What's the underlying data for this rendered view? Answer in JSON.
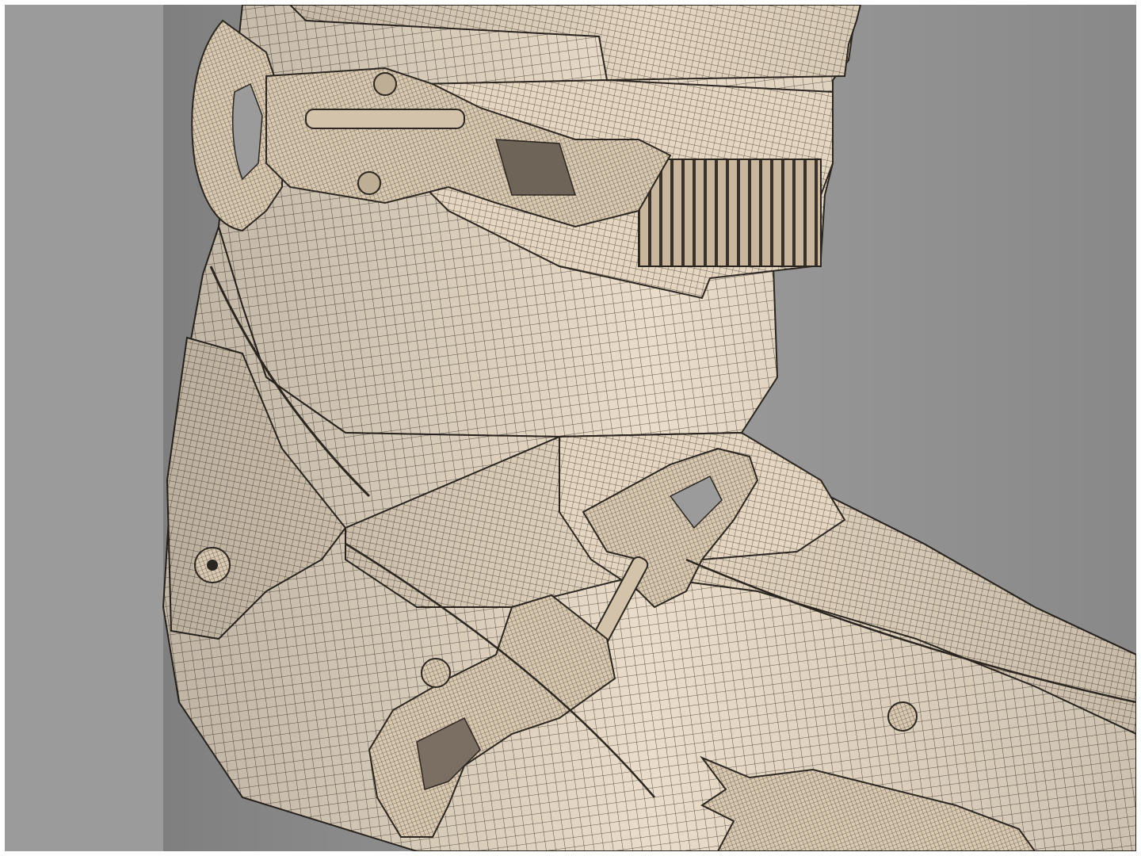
{
  "scene": {
    "subject": "ski-boot-wireframe",
    "background_color": "#9b9b9b",
    "surface_color": "#e9dcc8",
    "wire_color": "#2c2620"
  }
}
